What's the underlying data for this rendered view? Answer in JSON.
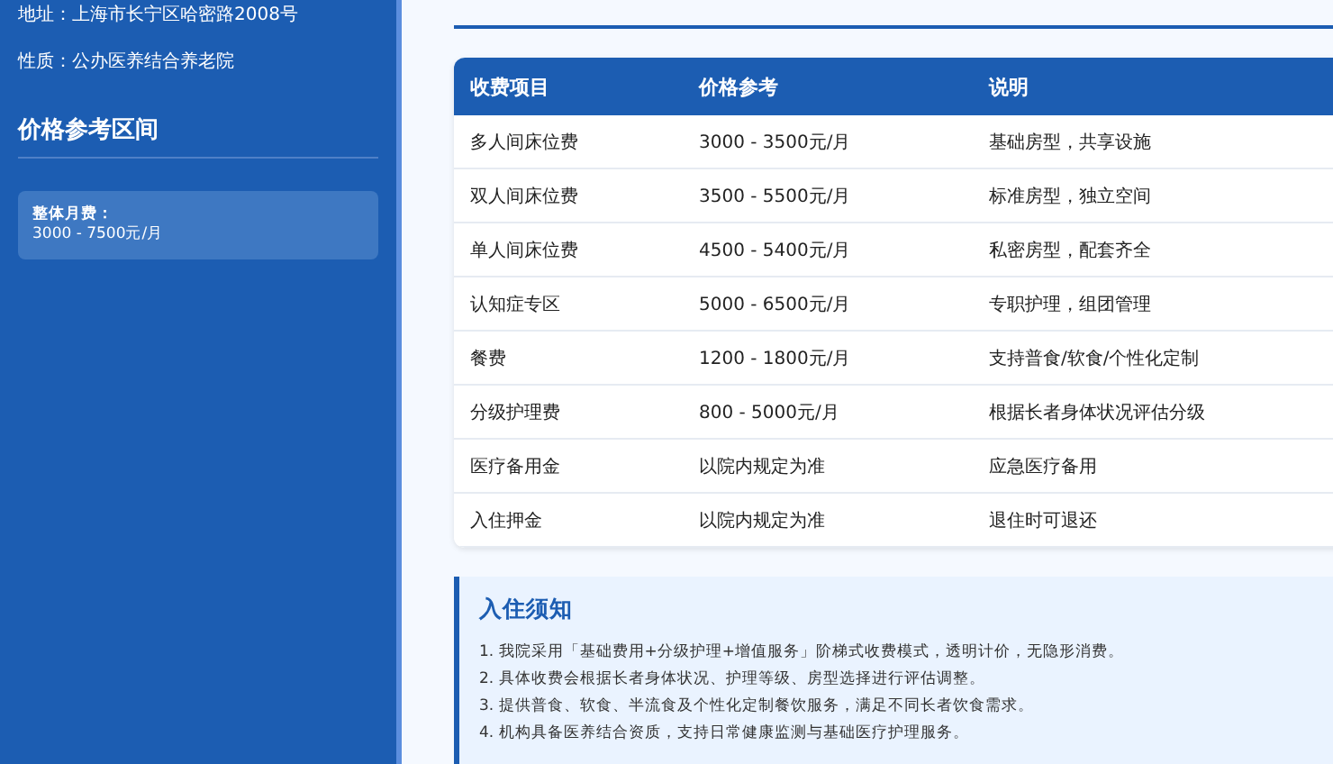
{
  "sidebar": {
    "info": [
      {
        "label": "地址：",
        "value": "上海市长宁区哈密路2008号"
      },
      {
        "label": "性质：",
        "value": "公办医养结合养老院"
      }
    ],
    "price_section": {
      "title": "价格参考区间",
      "card": {
        "label": "整体月费：",
        "value": "3000 - 7500元/月"
      }
    }
  },
  "fee_table": {
    "columns": [
      "收费项目",
      "价格参考",
      "说明"
    ],
    "rows": [
      [
        "多人间床位费",
        "3000 - 3500元/月",
        "基础房型，共享设施"
      ],
      [
        "双人间床位费",
        "3500 - 5500元/月",
        "标准房型，独立空间"
      ],
      [
        "单人间床位费",
        "4500 - 5400元/月",
        "私密房型，配套齐全"
      ],
      [
        "认知症专区",
        "5000 - 6500元/月",
        "专职护理，组团管理"
      ],
      [
        "餐费",
        "1200 - 1800元/月",
        "支持普食/软食/个性化定制"
      ],
      [
        "分级护理费",
        "800 - 5000元/月",
        "根据长者身体状况评估分级"
      ],
      [
        "医疗备用金",
        "以院内规定为准",
        "应急医疗备用"
      ],
      [
        "入住押金",
        "以院内规定为准",
        "退住时可退还"
      ]
    ]
  },
  "notice": {
    "title": "入住须知",
    "items": [
      "1. 我院采用「基础费用+分级护理+增值服务」阶梯式收费模式，透明计价，无隐形消费。",
      "2. 具体收费会根据长者身体状况、护理等级、房型选择进行评估调整。",
      "3. 提供普食、软食、半流食及个性化定制餐饮服务，满足不同长者饮食需求。",
      "4. 机构具备医养结合资质，支持日常健康监测与基础医疗护理服务。"
    ]
  }
}
